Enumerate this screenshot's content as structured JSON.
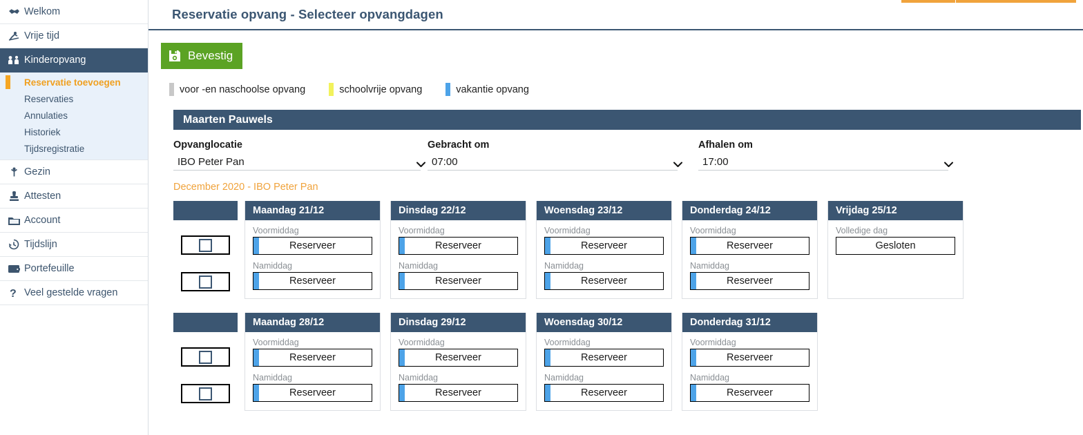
{
  "sidebar": {
    "items": [
      {
        "label": "Welkom",
        "icon": "handshake-icon",
        "active": false
      },
      {
        "label": "Vrije tijd",
        "icon": "ski-icon",
        "active": false
      },
      {
        "label": "Kinderopvang",
        "icon": "children-icon",
        "active": true
      },
      {
        "label": "Gezin",
        "icon": "family-icon",
        "active": false
      },
      {
        "label": "Attesten",
        "icon": "stamp-icon",
        "active": false
      },
      {
        "label": "Account",
        "icon": "folder-icon",
        "active": false
      },
      {
        "label": "Tijdslijn",
        "icon": "history-clock-icon",
        "active": false
      },
      {
        "label": "Portefeuille",
        "icon": "wallet-icon",
        "active": false
      },
      {
        "label": "Veel gestelde vragen",
        "icon": "question-mark-icon",
        "active": false
      }
    ],
    "submenu": [
      {
        "label": "Reservatie toevoegen",
        "current": true
      },
      {
        "label": "Reservaties",
        "current": false
      },
      {
        "label": "Annulaties",
        "current": false
      },
      {
        "label": "Historiek",
        "current": false
      },
      {
        "label": "Tijdsregistratie",
        "current": false
      }
    ]
  },
  "header": {
    "title": "Reservatie opvang - Selecteer opvangdagen"
  },
  "toolbar": {
    "confirm_label": "Bevestig",
    "confirm_icon": "save-floppy-icon",
    "confirm_color": "#5ba324"
  },
  "legend": [
    {
      "label": "voor -en naschoolse opvang",
      "color": "#c8c8c8"
    },
    {
      "label": "schoolvrije opvang",
      "color": "#f2f25c"
    },
    {
      "label": "vakantie opvang",
      "color": "#4da3e8"
    }
  ],
  "person": {
    "name": "Maarten Pauwels"
  },
  "form": {
    "location": {
      "label": "Opvanglocatie",
      "value": "IBO Peter Pan"
    },
    "dropoff": {
      "label": "Gebracht om",
      "value": "07:00"
    },
    "pickup": {
      "label": "Afhalen om",
      "value": "17:00"
    }
  },
  "month_label": "December 2020 - IBO Peter Pan",
  "calendar": {
    "rows": [
      {
        "checkbox_column": {
          "header": "",
          "checkboxes": [
            "",
            ""
          ]
        },
        "days": [
          {
            "title": "Maandag 21/12",
            "closed": false,
            "slots": [
              {
                "label": "Voormiddag",
                "action": "Reserveer",
                "bar": "#4da3e8"
              },
              {
                "label": "Namiddag",
                "action": "Reserveer",
                "bar": "#4da3e8"
              }
            ]
          },
          {
            "title": "Dinsdag 22/12",
            "closed": false,
            "slots": [
              {
                "label": "Voormiddag",
                "action": "Reserveer",
                "bar": "#4da3e8"
              },
              {
                "label": "Namiddag",
                "action": "Reserveer",
                "bar": "#4da3e8"
              }
            ]
          },
          {
            "title": "Woensdag 23/12",
            "closed": false,
            "slots": [
              {
                "label": "Voormiddag",
                "action": "Reserveer",
                "bar": "#4da3e8"
              },
              {
                "label": "Namiddag",
                "action": "Reserveer",
                "bar": "#4da3e8"
              }
            ]
          },
          {
            "title": "Donderdag 24/12",
            "closed": false,
            "slots": [
              {
                "label": "Voormiddag",
                "action": "Reserveer",
                "bar": "#4da3e8"
              },
              {
                "label": "Namiddag",
                "action": "Reserveer",
                "bar": "#4da3e8"
              }
            ]
          },
          {
            "title": "Vrijdag 25/12",
            "closed": true,
            "slots": [
              {
                "label": "Volledige dag",
                "action": "Gesloten",
                "bar": ""
              }
            ]
          }
        ]
      },
      {
        "checkbox_column": {
          "header": "",
          "checkboxes": [
            "",
            ""
          ]
        },
        "days": [
          {
            "title": "Maandag 28/12",
            "closed": false,
            "slots": [
              {
                "label": "Voormiddag",
                "action": "Reserveer",
                "bar": "#4da3e8"
              },
              {
                "label": "Namiddag",
                "action": "Reserveer",
                "bar": "#4da3e8"
              }
            ]
          },
          {
            "title": "Dinsdag 29/12",
            "closed": false,
            "slots": [
              {
                "label": "Voormiddag",
                "action": "Reserveer",
                "bar": "#4da3e8"
              },
              {
                "label": "Namiddag",
                "action": "Reserveer",
                "bar": "#4da3e8"
              }
            ]
          },
          {
            "title": "Woensdag 30/12",
            "closed": false,
            "slots": [
              {
                "label": "Voormiddag",
                "action": "Reserveer",
                "bar": "#4da3e8"
              },
              {
                "label": "Namiddag",
                "action": "Reserveer",
                "bar": "#4da3e8"
              }
            ]
          },
          {
            "title": "Donderdag 31/12",
            "closed": false,
            "slots": [
              {
                "label": "Voormiddag",
                "action": "Reserveer",
                "bar": "#4da3e8"
              },
              {
                "label": "Namiddag",
                "action": "Reserveer",
                "bar": "#4da3e8"
              }
            ]
          }
        ]
      }
    ]
  },
  "colors": {
    "navy": "#3b5672",
    "orange": "#f0a33c",
    "green": "#5ba324",
    "blue_bar": "#4da3e8"
  }
}
